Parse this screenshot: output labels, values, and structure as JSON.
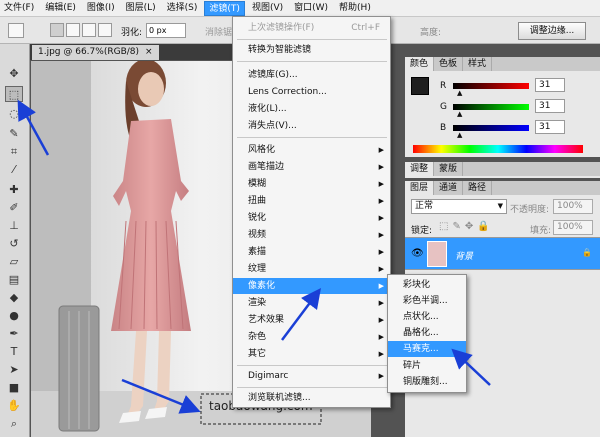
{
  "menubar": {
    "items": [
      "文件(F)",
      "编辑(E)",
      "图像(I)",
      "图层(L)",
      "选择(S)",
      "滤镜(T)",
      "视图(V)",
      "窗口(W)",
      "帮助(H)"
    ]
  },
  "options": {
    "feather_label": "羽化:",
    "feather_value": "0 px",
    "anti_alias_label": "消除锯齿",
    "height_label": "高度:",
    "refine_edge": "调整边缘..."
  },
  "document": {
    "tab_title": "1.jpg @ 66.7%(RGB/8)",
    "close": "×",
    "watermark": "taobaowang.com"
  },
  "filter_menu": {
    "last_filter": "上次滤镜操作(F)",
    "last_filter_shortcut": "Ctrl+F",
    "convert_smart": "转换为智能滤镜",
    "gallery": "滤镜库(G)...",
    "lens_correction": "Lens Correction...",
    "liquify": "液化(L)...",
    "vanishing_point": "消失点(V)...",
    "groups": [
      "风格化",
      "画笔描边",
      "模糊",
      "扭曲",
      "锐化",
      "视频",
      "素描",
      "纹理",
      "像素化",
      "渲染",
      "艺术效果",
      "杂色",
      "其它"
    ],
    "digimarc": "Digimarc",
    "browse_online": "浏览联机滤镜..."
  },
  "pixelate_submenu": {
    "items": [
      "彩块化",
      "彩色半调...",
      "点状化...",
      "晶格化...",
      "马赛克...",
      "碎片",
      "铜版雕刻..."
    ]
  },
  "color_panel": {
    "tabs": [
      "颜色",
      "色板",
      "样式"
    ],
    "r_label": "R",
    "g_label": "G",
    "b_label": "B",
    "r_value": "31",
    "g_value": "31",
    "b_value": "31",
    "swatch_color": "#1f1f1f"
  },
  "adjust_panel": {
    "tabs": [
      "调整",
      "蒙版"
    ]
  },
  "layers_panel": {
    "tabs": [
      "图层",
      "通道",
      "路径"
    ],
    "blend_mode": "正常",
    "opacity_label": "不透明度:",
    "opacity_value": "100%",
    "lock_label": "锁定:",
    "fill_label": "填充:",
    "fill_value": "100%",
    "layer_name": "背景"
  },
  "colors": {
    "accent": "#3399ff",
    "arrow": "#1a3fd6"
  }
}
